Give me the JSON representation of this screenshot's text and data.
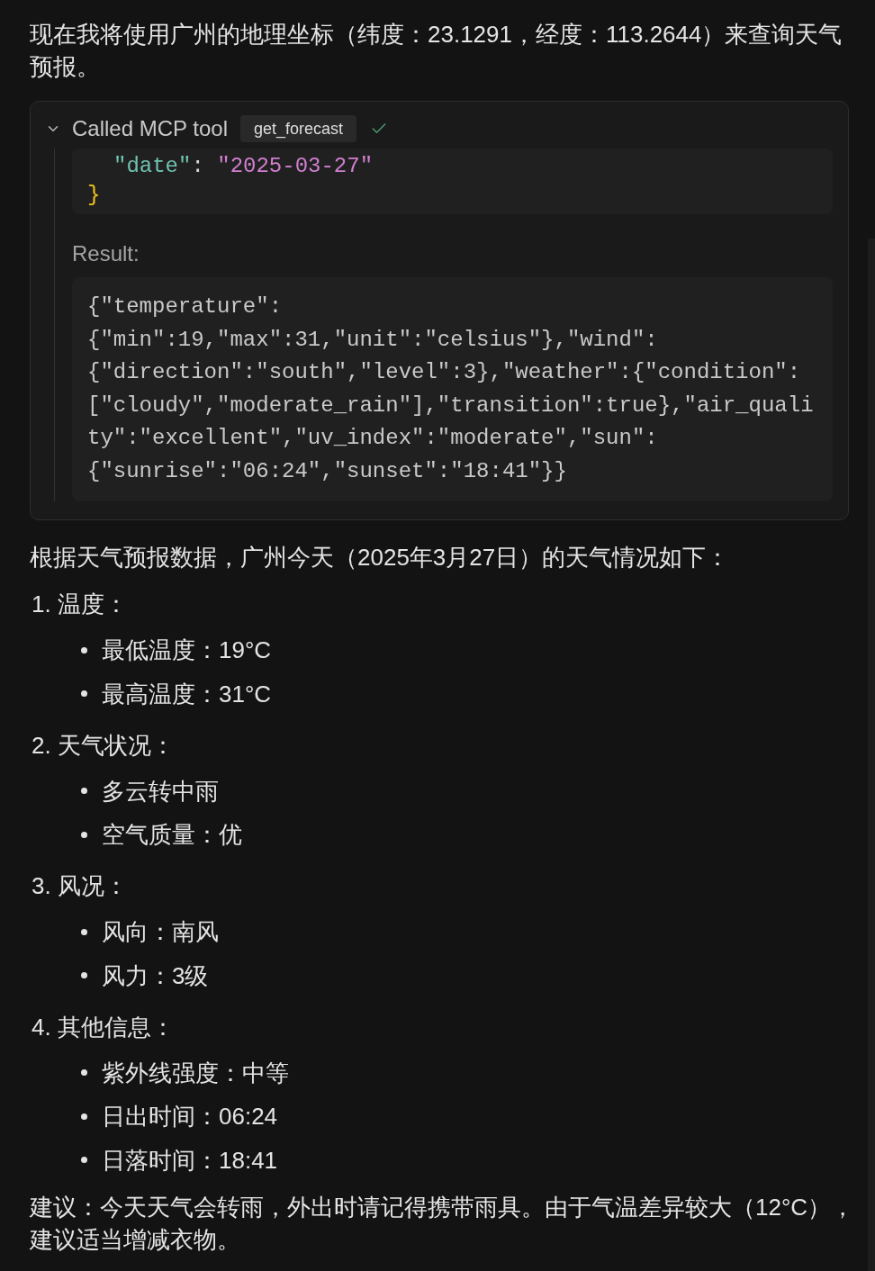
{
  "intro": "现在我将使用广州的地理坐标（纬度：23.1291，经度：113.2644）来查询天气预报。",
  "tool_call": {
    "expanded": true,
    "label": "Called MCP tool",
    "tool_name": "get_forecast",
    "succeeded": true,
    "arguments": [
      {
        "kind": "member",
        "key": "\"date\"",
        "separator": ": ",
        "value": "\"2025-03-27\""
      },
      {
        "kind": "close",
        "text": "}"
      }
    ],
    "result_label": "Result:",
    "result": "{\"temperature\":{\"min\":19,\"max\":31,\"unit\":\"celsius\"},\"wind\":{\"direction\":\"south\",\"level\":3},\"weather\":{\"condition\":[\"cloudy\",\"moderate_rain\"],\"transition\":true},\"air_quality\":\"excellent\",\"uv_index\":\"moderate\",\"sun\":{\"sunrise\":\"06:24\",\"sunset\":\"18:41\"}}"
  },
  "summary": "根据天气预报数据，广州今天（2025年3月27日）的天气情况如下：",
  "sections": [
    {
      "heading": "1. 温度：",
      "items": [
        "最低温度：19°C",
        "最高温度：31°C"
      ]
    },
    {
      "heading": "2. 天气状况：",
      "items": [
        "多云转中雨",
        "空气质量：优"
      ]
    },
    {
      "heading": "3. 风况：",
      "items": [
        "风向：南风",
        "风力：3级"
      ]
    },
    {
      "heading": "4. 其他信息：",
      "items": [
        "紫外线强度：中等",
        "日出时间：06:24",
        "日落时间：18:41"
      ]
    }
  ],
  "advice": "建议：今天天气会转雨，外出时请记得携带雨具。由于气温差异较大（12°C），建议适当增减衣物。"
}
